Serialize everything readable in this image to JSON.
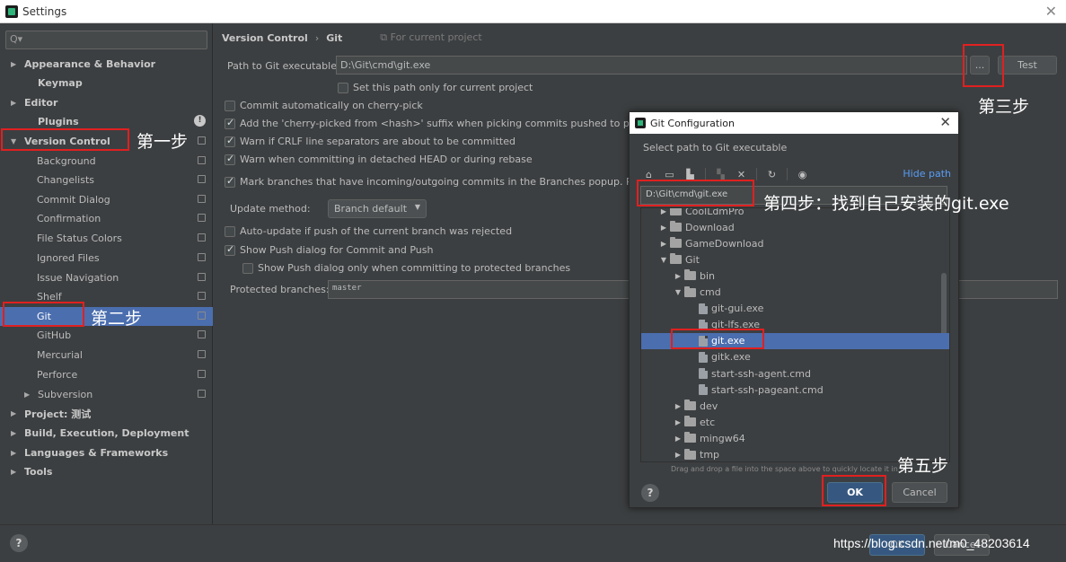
{
  "window": {
    "title": "Settings",
    "close": "✕"
  },
  "sidebar": {
    "search_icon": "Q▾",
    "items": [
      {
        "label": "Appearance & Behavior",
        "arrow": "▶"
      },
      {
        "label": "Keymap"
      },
      {
        "label": "Editor",
        "arrow": "▶"
      },
      {
        "label": "Plugins",
        "info": "!"
      },
      {
        "label": "Version Control",
        "arrow": "▼"
      },
      {
        "label": "Background"
      },
      {
        "label": "Changelists"
      },
      {
        "label": "Commit Dialog"
      },
      {
        "label": "Confirmation"
      },
      {
        "label": "File Status Colors"
      },
      {
        "label": "Ignored Files"
      },
      {
        "label": "Issue Navigation"
      },
      {
        "label": "Shelf"
      },
      {
        "label": "Git"
      },
      {
        "label": "GitHub"
      },
      {
        "label": "Mercurial"
      },
      {
        "label": "Perforce"
      },
      {
        "label": "Subversion",
        "arrow": "▶"
      },
      {
        "label": "Project: 测试",
        "arrow": "▶"
      },
      {
        "label": "Build, Execution, Deployment",
        "arrow": "▶"
      },
      {
        "label": "Languages & Frameworks",
        "arrow": "▶"
      },
      {
        "label": "Tools",
        "arrow": "▶"
      }
    ]
  },
  "breadcrumb": {
    "first": "Version Control",
    "separator": "›",
    "second": "Git",
    "for_project": "For current project"
  },
  "git": {
    "path_label": "Path to Git executable:",
    "path_value": "D:\\Git\\cmd\\git.exe",
    "browse_label": "...",
    "test_label": "Test",
    "set_path_only": "Set this path only for current project",
    "options": [
      {
        "label": "Commit automatically on cherry-pick",
        "checked": false
      },
      {
        "label": "Add the 'cherry-picked from <hash>' suffix when picking commits pushed to protected",
        "checked": true
      },
      {
        "label": "Warn if CRLF line separators are about to be committed",
        "checked": true
      },
      {
        "label": "Warn when committing in detached HEAD or during rebase",
        "checked": true
      },
      {
        "label": "Mark branches that have incoming/outgoing commits in the Branches popup.  Refresh",
        "checked": true
      }
    ],
    "update_method_label": "Update method:",
    "update_method_value": "Branch default",
    "auto_update": "Auto-update if push of the current branch was rejected",
    "show_push": "Show Push dialog for Commit and Push",
    "show_push_protected": "Show Push dialog only when committing to protected branches",
    "protected_label": "Protected branches:",
    "protected_value": "master"
  },
  "dialog": {
    "title": "Git Configuration",
    "close": "✕",
    "subtitle": "Select path to Git executable",
    "hide_path": "Hide path",
    "path_value": "D:\\Git\\cmd\\git.exe",
    "rows": [
      {
        "label": "CoolLdmPro",
        "indent": 0,
        "type": "folder",
        "arrow": "▶"
      },
      {
        "label": "Download",
        "indent": 0,
        "type": "folder",
        "arrow": "▶"
      },
      {
        "label": "GameDownload",
        "indent": 0,
        "type": "folder",
        "arrow": "▶"
      },
      {
        "label": "Git",
        "indent": 0,
        "type": "folder",
        "arrow": "▼"
      },
      {
        "label": "bin",
        "indent": 1,
        "type": "folder",
        "arrow": "▶"
      },
      {
        "label": "cmd",
        "indent": 1,
        "type": "folder",
        "arrow": "▼"
      },
      {
        "label": "git-gui.exe",
        "indent": 2,
        "type": "file"
      },
      {
        "label": "git-lfs.exe",
        "indent": 2,
        "type": "file"
      },
      {
        "label": "git.exe",
        "indent": 2,
        "type": "file",
        "selected": true
      },
      {
        "label": "gitk.exe",
        "indent": 2,
        "type": "file"
      },
      {
        "label": "start-ssh-agent.cmd",
        "indent": 2,
        "type": "file"
      },
      {
        "label": "start-ssh-pageant.cmd",
        "indent": 2,
        "type": "file"
      },
      {
        "label": "dev",
        "indent": 1,
        "type": "folder",
        "arrow": "▶"
      },
      {
        "label": "etc",
        "indent": 1,
        "type": "folder",
        "arrow": "▶"
      },
      {
        "label": "mingw64",
        "indent": 1,
        "type": "folder",
        "arrow": "▶"
      },
      {
        "label": "tmp",
        "indent": 1,
        "type": "folder",
        "arrow": "▶"
      }
    ],
    "drag_hint": "Drag and drop a file into the space above to quickly locate it in t",
    "help": "?",
    "ok_label": "OK",
    "cancel_label": "Cancel"
  },
  "footer": {
    "help": "?",
    "ok_label": "OK",
    "cancel_label": "Cancel"
  },
  "annotations": {
    "step1": "第一步",
    "step2": "第二步",
    "step3": "第三步",
    "step4": "第四步：找到自己安装的git.exe",
    "step5": "第五步"
  },
  "watermark": "https://blog.csdn.net/m0_48203614",
  "colors": {
    "accent": "#4b6eaf",
    "link": "#589df6",
    "annotation": "#e02020",
    "background": "#3c3f41"
  }
}
